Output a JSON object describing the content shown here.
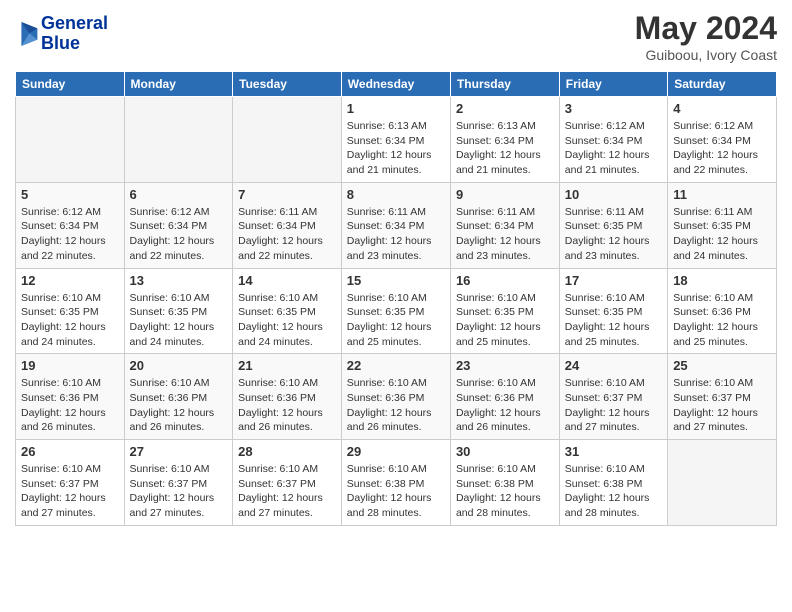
{
  "header": {
    "logo_line1": "General",
    "logo_line2": "Blue",
    "month_year": "May 2024",
    "location": "Guiboou, Ivory Coast"
  },
  "weekdays": [
    "Sunday",
    "Monday",
    "Tuesday",
    "Wednesday",
    "Thursday",
    "Friday",
    "Saturday"
  ],
  "weeks": [
    [
      {
        "day": "",
        "info": ""
      },
      {
        "day": "",
        "info": ""
      },
      {
        "day": "",
        "info": ""
      },
      {
        "day": "1",
        "info": "Sunrise: 6:13 AM\nSunset: 6:34 PM\nDaylight: 12 hours\nand 21 minutes."
      },
      {
        "day": "2",
        "info": "Sunrise: 6:13 AM\nSunset: 6:34 PM\nDaylight: 12 hours\nand 21 minutes."
      },
      {
        "day": "3",
        "info": "Sunrise: 6:12 AM\nSunset: 6:34 PM\nDaylight: 12 hours\nand 21 minutes."
      },
      {
        "day": "4",
        "info": "Sunrise: 6:12 AM\nSunset: 6:34 PM\nDaylight: 12 hours\nand 22 minutes."
      }
    ],
    [
      {
        "day": "5",
        "info": "Sunrise: 6:12 AM\nSunset: 6:34 PM\nDaylight: 12 hours\nand 22 minutes."
      },
      {
        "day": "6",
        "info": "Sunrise: 6:12 AM\nSunset: 6:34 PM\nDaylight: 12 hours\nand 22 minutes."
      },
      {
        "day": "7",
        "info": "Sunrise: 6:11 AM\nSunset: 6:34 PM\nDaylight: 12 hours\nand 22 minutes."
      },
      {
        "day": "8",
        "info": "Sunrise: 6:11 AM\nSunset: 6:34 PM\nDaylight: 12 hours\nand 23 minutes."
      },
      {
        "day": "9",
        "info": "Sunrise: 6:11 AM\nSunset: 6:34 PM\nDaylight: 12 hours\nand 23 minutes."
      },
      {
        "day": "10",
        "info": "Sunrise: 6:11 AM\nSunset: 6:35 PM\nDaylight: 12 hours\nand 23 minutes."
      },
      {
        "day": "11",
        "info": "Sunrise: 6:11 AM\nSunset: 6:35 PM\nDaylight: 12 hours\nand 24 minutes."
      }
    ],
    [
      {
        "day": "12",
        "info": "Sunrise: 6:10 AM\nSunset: 6:35 PM\nDaylight: 12 hours\nand 24 minutes."
      },
      {
        "day": "13",
        "info": "Sunrise: 6:10 AM\nSunset: 6:35 PM\nDaylight: 12 hours\nand 24 minutes."
      },
      {
        "day": "14",
        "info": "Sunrise: 6:10 AM\nSunset: 6:35 PM\nDaylight: 12 hours\nand 24 minutes."
      },
      {
        "day": "15",
        "info": "Sunrise: 6:10 AM\nSunset: 6:35 PM\nDaylight: 12 hours\nand 25 minutes."
      },
      {
        "day": "16",
        "info": "Sunrise: 6:10 AM\nSunset: 6:35 PM\nDaylight: 12 hours\nand 25 minutes."
      },
      {
        "day": "17",
        "info": "Sunrise: 6:10 AM\nSunset: 6:35 PM\nDaylight: 12 hours\nand 25 minutes."
      },
      {
        "day": "18",
        "info": "Sunrise: 6:10 AM\nSunset: 6:36 PM\nDaylight: 12 hours\nand 25 minutes."
      }
    ],
    [
      {
        "day": "19",
        "info": "Sunrise: 6:10 AM\nSunset: 6:36 PM\nDaylight: 12 hours\nand 26 minutes."
      },
      {
        "day": "20",
        "info": "Sunrise: 6:10 AM\nSunset: 6:36 PM\nDaylight: 12 hours\nand 26 minutes."
      },
      {
        "day": "21",
        "info": "Sunrise: 6:10 AM\nSunset: 6:36 PM\nDaylight: 12 hours\nand 26 minutes."
      },
      {
        "day": "22",
        "info": "Sunrise: 6:10 AM\nSunset: 6:36 PM\nDaylight: 12 hours\nand 26 minutes."
      },
      {
        "day": "23",
        "info": "Sunrise: 6:10 AM\nSunset: 6:36 PM\nDaylight: 12 hours\nand 26 minutes."
      },
      {
        "day": "24",
        "info": "Sunrise: 6:10 AM\nSunset: 6:37 PM\nDaylight: 12 hours\nand 27 minutes."
      },
      {
        "day": "25",
        "info": "Sunrise: 6:10 AM\nSunset: 6:37 PM\nDaylight: 12 hours\nand 27 minutes."
      }
    ],
    [
      {
        "day": "26",
        "info": "Sunrise: 6:10 AM\nSunset: 6:37 PM\nDaylight: 12 hours\nand 27 minutes."
      },
      {
        "day": "27",
        "info": "Sunrise: 6:10 AM\nSunset: 6:37 PM\nDaylight: 12 hours\nand 27 minutes."
      },
      {
        "day": "28",
        "info": "Sunrise: 6:10 AM\nSunset: 6:37 PM\nDaylight: 12 hours\nand 27 minutes."
      },
      {
        "day": "29",
        "info": "Sunrise: 6:10 AM\nSunset: 6:38 PM\nDaylight: 12 hours\nand 28 minutes."
      },
      {
        "day": "30",
        "info": "Sunrise: 6:10 AM\nSunset: 6:38 PM\nDaylight: 12 hours\nand 28 minutes."
      },
      {
        "day": "31",
        "info": "Sunrise: 6:10 AM\nSunset: 6:38 PM\nDaylight: 12 hours\nand 28 minutes."
      },
      {
        "day": "",
        "info": ""
      }
    ]
  ],
  "colors": {
    "header_bg": "#2a6db5",
    "header_text": "#ffffff",
    "title_color": "#333333",
    "logo_color": "#003399"
  }
}
